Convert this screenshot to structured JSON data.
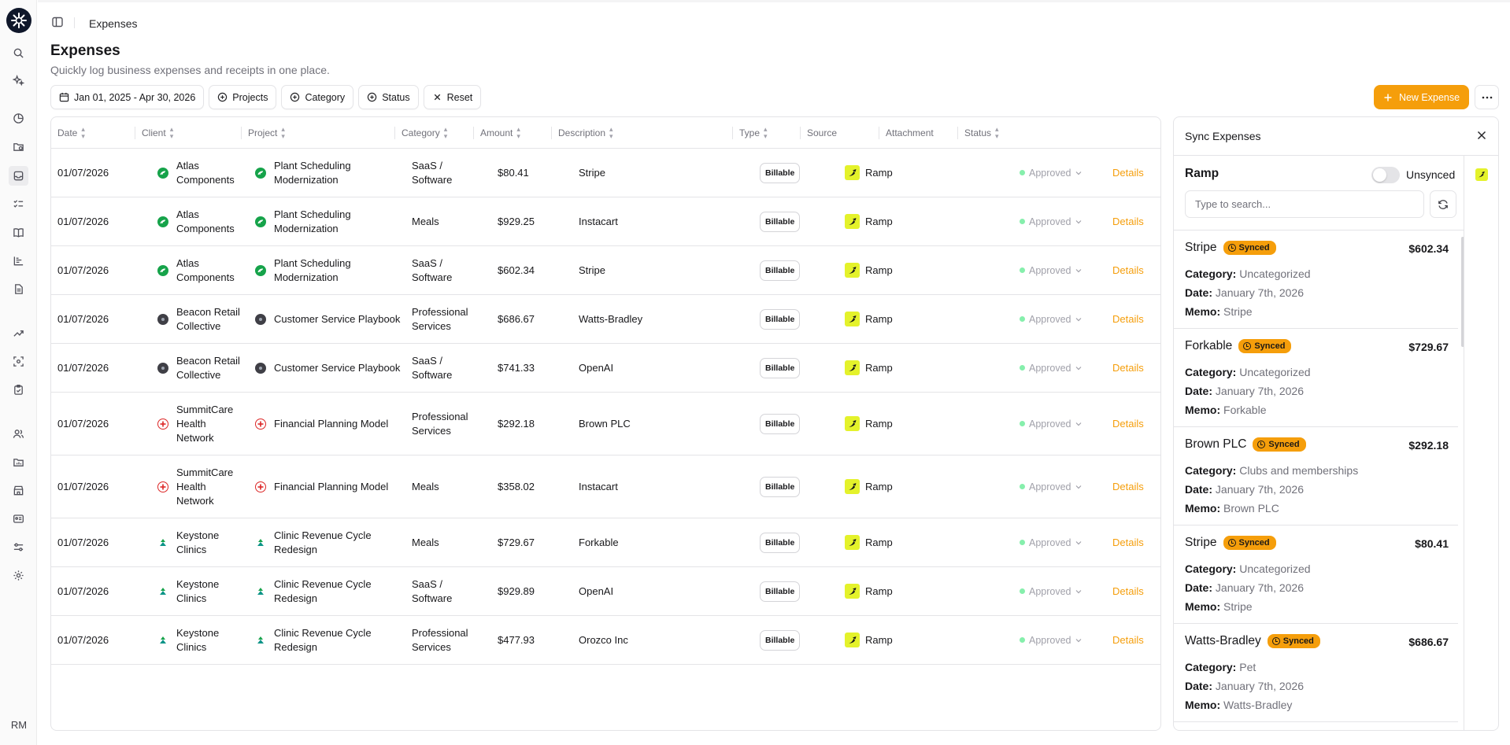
{
  "breadcrumb": "Expenses",
  "page": {
    "title": "Expenses",
    "subtitle": "Quickly log business expenses and receipts in one place."
  },
  "filters": {
    "date_range": "Jan 01, 2025 - Apr 30, 2026",
    "projects": "Projects",
    "category": "Category",
    "status": "Status",
    "reset": "Reset"
  },
  "actions": {
    "new_expense": "New Expense"
  },
  "colors": {
    "accent": "#f59e0b",
    "ramp": "#e4f22b",
    "approved_dot": "#86efac"
  },
  "user_initials": "RM",
  "table": {
    "columns": [
      "Date",
      "Client",
      "Project",
      "Category",
      "Amount",
      "Description",
      "Type",
      "Source",
      "Attachment",
      "Status"
    ],
    "rows": [
      {
        "date": "01/07/2026",
        "client": "Atlas Components",
        "client_icon": "green",
        "project": "Plant Scheduling Modernization",
        "category": "SaaS / Software",
        "amount": "$80.41",
        "description": "Stripe",
        "type": "Billable",
        "source": "Ramp",
        "status": "Approved",
        "action": "Details"
      },
      {
        "date": "01/07/2026",
        "client": "Atlas Components",
        "client_icon": "green",
        "project": "Plant Scheduling Modernization",
        "category": "Meals",
        "amount": "$929.25",
        "description": "Instacart",
        "type": "Billable",
        "source": "Ramp",
        "status": "Approved",
        "action": "Details"
      },
      {
        "date": "01/07/2026",
        "client": "Atlas Components",
        "client_icon": "green",
        "project": "Plant Scheduling Modernization",
        "category": "SaaS / Software",
        "amount": "$602.34",
        "description": "Stripe",
        "type": "Billable",
        "source": "Ramp",
        "status": "Approved",
        "action": "Details"
      },
      {
        "date": "01/07/2026",
        "client": "Beacon Retail Collective",
        "client_icon": "dark",
        "project": "Customer Service Playbook",
        "category": "Professional Services",
        "amount": "$686.67",
        "description": "Watts-Bradley",
        "type": "Billable",
        "source": "Ramp",
        "status": "Approved",
        "action": "Details"
      },
      {
        "date": "01/07/2026",
        "client": "Beacon Retail Collective",
        "client_icon": "dark",
        "project": "Customer Service Playbook",
        "category": "SaaS / Software",
        "amount": "$741.33",
        "description": "OpenAI",
        "type": "Billable",
        "source": "Ramp",
        "status": "Approved",
        "action": "Details"
      },
      {
        "date": "01/07/2026",
        "client": "SummitCare Health Network",
        "client_icon": "red",
        "project": "Financial Planning Model",
        "category": "Professional Services",
        "amount": "$292.18",
        "description": "Brown PLC",
        "type": "Billable",
        "source": "Ramp",
        "status": "Approved",
        "action": "Details"
      },
      {
        "date": "01/07/2026",
        "client": "SummitCare Health Network",
        "client_icon": "red",
        "project": "Financial Planning Model",
        "category": "Meals",
        "amount": "$358.02",
        "description": "Instacart",
        "type": "Billable",
        "source": "Ramp",
        "status": "Approved",
        "action": "Details"
      },
      {
        "date": "01/07/2026",
        "client": "Keystone Clinics",
        "client_icon": "teal",
        "project": "Clinic Revenue Cycle Redesign",
        "category": "Meals",
        "amount": "$729.67",
        "description": "Forkable",
        "type": "Billable",
        "source": "Ramp",
        "status": "Approved",
        "action": "Details"
      },
      {
        "date": "01/07/2026",
        "client": "Keystone Clinics",
        "client_icon": "teal",
        "project": "Clinic Revenue Cycle Redesign",
        "category": "SaaS / Software",
        "amount": "$929.89",
        "description": "OpenAI",
        "type": "Billable",
        "source": "Ramp",
        "status": "Approved",
        "action": "Details"
      },
      {
        "date": "01/07/2026",
        "client": "Keystone Clinics",
        "client_icon": "teal",
        "project": "Clinic Revenue Cycle Redesign",
        "category": "Professional Services",
        "amount": "$477.93",
        "description": "Orozco Inc",
        "type": "Billable",
        "source": "Ramp",
        "status": "Approved",
        "action": "Details"
      }
    ]
  },
  "sync_panel": {
    "title": "Sync Expenses",
    "provider": "Ramp",
    "toggle_label": "Unsynced",
    "search_placeholder": "Type to search...",
    "labels": {
      "category": "Category:",
      "date": "Date:",
      "memo": "Memo:"
    },
    "items": [
      {
        "name": "Stripe",
        "badge": "Synced",
        "amount": "$602.34",
        "category": "Uncategorized",
        "date": "January 7th, 2026",
        "memo": "Stripe"
      },
      {
        "name": "Forkable",
        "badge": "Synced",
        "amount": "$729.67",
        "category": "Uncategorized",
        "date": "January 7th, 2026",
        "memo": "Forkable"
      },
      {
        "name": "Brown PLC",
        "badge": "Synced",
        "amount": "$292.18",
        "category": "Clubs and memberships",
        "date": "January 7th, 2026",
        "memo": "Brown PLC"
      },
      {
        "name": "Stripe",
        "badge": "Synced",
        "amount": "$80.41",
        "category": "Uncategorized",
        "date": "January 7th, 2026",
        "memo": "Stripe"
      },
      {
        "name": "Watts-Bradley",
        "badge": "Synced",
        "amount": "$686.67",
        "category": "Pet",
        "date": "January 7th, 2026",
        "memo": "Watts-Bradley"
      }
    ]
  }
}
